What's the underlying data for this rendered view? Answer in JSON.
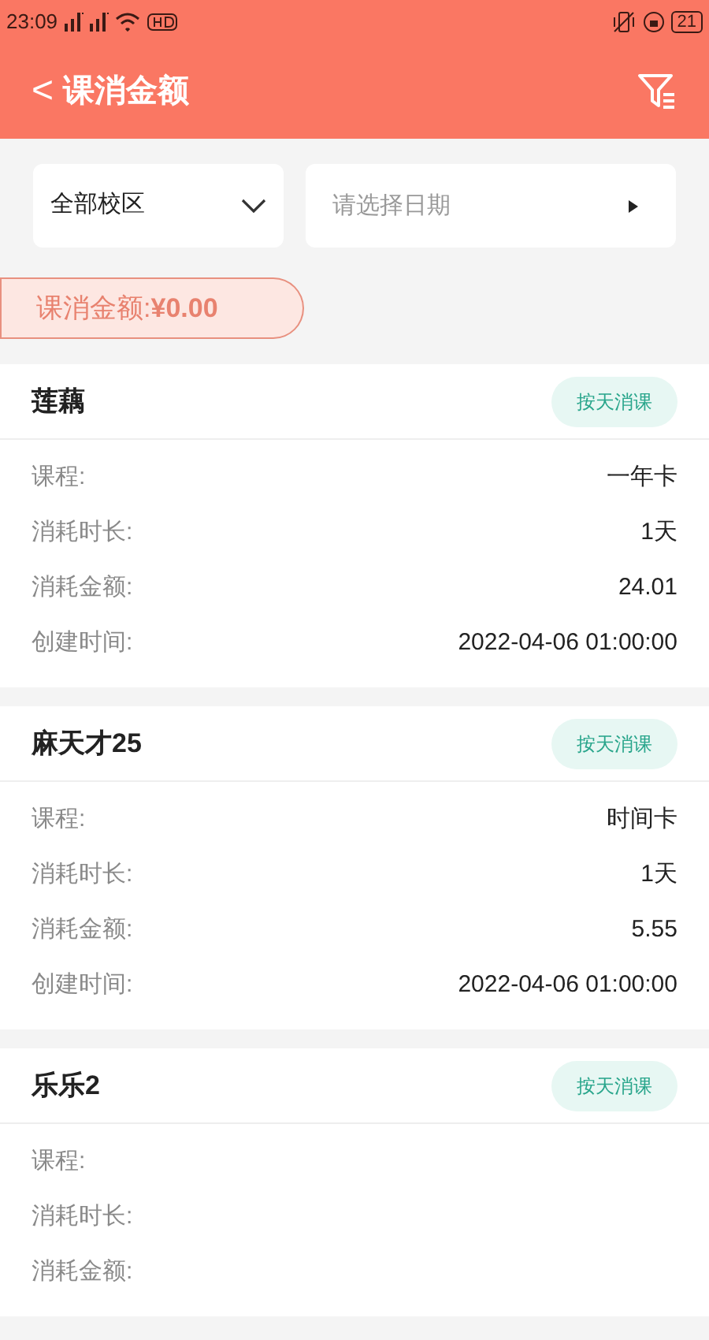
{
  "status_bar": {
    "time": "23:09",
    "battery": "21"
  },
  "header": {
    "back": "<",
    "title": "课消金额"
  },
  "filters": {
    "campus": "全部校区",
    "date_placeholder": "请选择日期"
  },
  "total": {
    "label": "课消金额:",
    "amount": "¥0.00"
  },
  "records": [
    {
      "name": "莲藕",
      "badge": "按天消课",
      "rows": [
        {
          "label": "课程:",
          "value": "一年卡"
        },
        {
          "label": "消耗时长:",
          "value": "1天"
        },
        {
          "label": "消耗金额:",
          "value": "24.01"
        },
        {
          "label": "创建时间:",
          "value": "2022-04-06 01:00:00"
        }
      ]
    },
    {
      "name": "麻天才25",
      "badge": "按天消课",
      "rows": [
        {
          "label": "课程:",
          "value": "时间卡"
        },
        {
          "label": "消耗时长:",
          "value": "1天"
        },
        {
          "label": "消耗金额:",
          "value": "5.55"
        },
        {
          "label": "创建时间:",
          "value": "2022-04-06 01:00:00"
        }
      ]
    },
    {
      "name": "乐乐2",
      "badge": "按天消课",
      "rows": [
        {
          "label": "课程:"
        },
        {
          "label": "消耗时长:"
        },
        {
          "label": "消耗金额:"
        }
      ]
    }
  ]
}
